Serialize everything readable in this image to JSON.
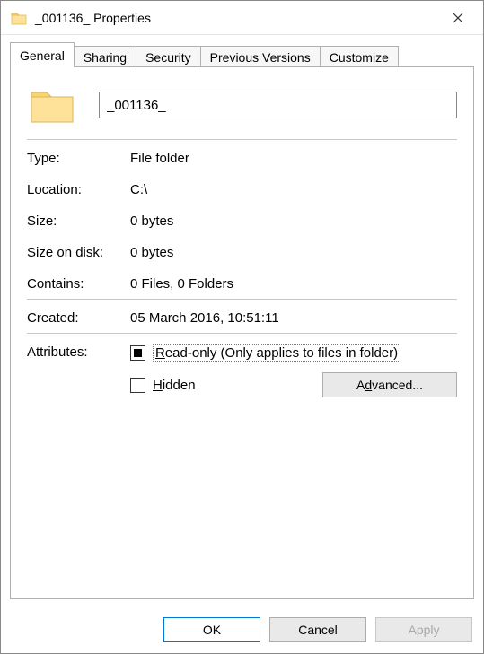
{
  "window": {
    "title": "_001136_ Properties"
  },
  "tabs": {
    "general": "General",
    "sharing": "Sharing",
    "security": "Security",
    "previous": "Previous Versions",
    "customize": "Customize"
  },
  "general": {
    "name_value": "_001136_",
    "labels": {
      "type": "Type:",
      "location": "Location:",
      "size": "Size:",
      "size_on_disk": "Size on disk:",
      "contains": "Contains:",
      "created": "Created:",
      "attributes": "Attributes:"
    },
    "values": {
      "type": "File folder",
      "location": "C:\\",
      "size": "0 bytes",
      "size_on_disk": "0 bytes",
      "contains": "0 Files, 0 Folders",
      "created": "05 March 2016, 10:51:11"
    },
    "attributes": {
      "readonly_prefix": "R",
      "readonly_rest": "ead-only (Only applies to files in folder)",
      "hidden_prefix": "H",
      "hidden_rest": "idden",
      "advanced_prefix": "A",
      "advanced_mid": "d",
      "advanced_rest": "vanced..."
    }
  },
  "buttons": {
    "ok": "OK",
    "cancel": "Cancel",
    "apply_prefix": "A",
    "apply_rest": "pply"
  }
}
